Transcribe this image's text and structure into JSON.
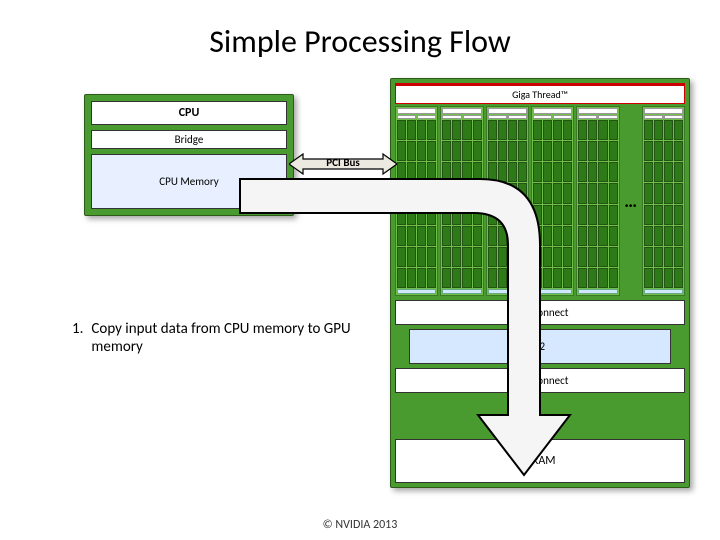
{
  "title": "Simple Processing Flow",
  "cpu": {
    "label": "CPU",
    "bridge": "Bridge",
    "memory": "CPU Memory"
  },
  "pci_label": "PCI Bus",
  "gpu": {
    "giga": "Giga Thread™",
    "ellipsis": "…",
    "interconnect": "Interconnect",
    "l2": "L2",
    "dram": "DRAM"
  },
  "step": {
    "num": "1.",
    "text": "Copy input data from CPU memory to GPU memory"
  },
  "footer": "© NVIDIA 2013"
}
